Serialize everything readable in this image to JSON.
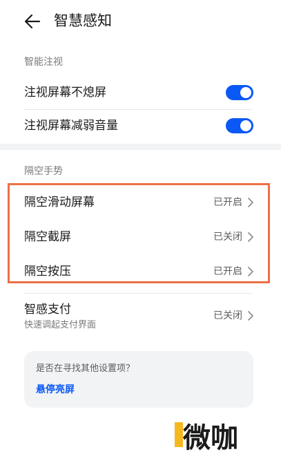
{
  "header": {
    "title": "智慧感知"
  },
  "smart_gaze": {
    "section_title": "智能注视",
    "items": [
      {
        "label": "注视屏幕不熄屏",
        "enabled": true
      },
      {
        "label": "注视屏幕减弱音量",
        "enabled": true
      }
    ]
  },
  "air_gestures": {
    "section_title": "隔空手势",
    "items": [
      {
        "label": "隔空滑动屏幕",
        "status": "已开启"
      },
      {
        "label": "隔空截屏",
        "status": "已关闭"
      },
      {
        "label": "隔空按压",
        "status": "已开启"
      }
    ]
  },
  "smart_pay": {
    "label": "智感支付",
    "subtitle": "快速调起支付界面",
    "status": "已关闭"
  },
  "suggestion": {
    "question": "是否在寻找其他设置项？",
    "link": "悬停亮屏"
  },
  "watermark": {
    "text": "微咖"
  },
  "colors": {
    "accent": "#0a59f7",
    "highlight": "#ec6f45",
    "background": "#f1f3f5"
  }
}
